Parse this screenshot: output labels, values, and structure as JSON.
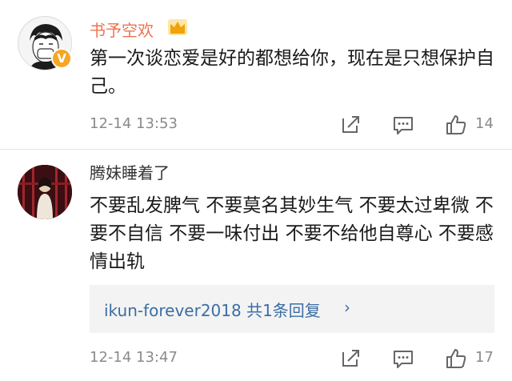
{
  "comments": [
    {
      "username": "书予空欢",
      "badge": "V",
      "content": "第一次谈恋爱是好的都想给你，现在是只想保护自己。",
      "timestamp": "12-14 13:53",
      "likes": "14"
    },
    {
      "username": "腾妹睡着了",
      "content": "不要乱发脾气 不要莫名其妙生气 不要太过卑微 不要不自信 不要一味付出 不要不给他自尊心 不要感情出轨",
      "reply_summary": "ikun-forever2018 共1条回复",
      "reply_chevron": "›",
      "timestamp": "12-14 13:47",
      "likes": "17"
    }
  ],
  "colors": {
    "username_highlight": "#eb7350",
    "link": "#3b6ea5",
    "meta": "#8a8a8a",
    "badge": "#f6a623"
  },
  "icons": [
    "crown-icon",
    "verified-badge-icon",
    "share-icon",
    "comment-icon",
    "like-icon"
  ]
}
